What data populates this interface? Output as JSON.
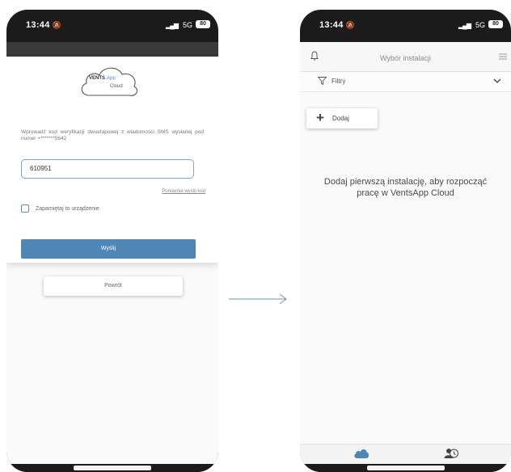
{
  "left_phone": {
    "status": {
      "time": "13:44",
      "network": "5G",
      "battery": "80"
    },
    "logo": {
      "brand": "VENTS",
      "app": "App",
      "sub": "Cloud"
    },
    "message": "Wprowadź kod weryfikacji dwuetapowej z wiadomości SMS wysłanej pod numer +*******5642",
    "code_input": {
      "value": "610951"
    },
    "resend_link": "Ponownie wyślij kod",
    "remember_label": "Zapamiętaj to urządzenie",
    "send_button": "Wyślij",
    "back_button": "Powrót"
  },
  "right_phone": {
    "status": {
      "time": "13:44",
      "network": "5G",
      "battery": "80"
    },
    "header_title": "Wybór instalacji",
    "filter_label": "Filtry",
    "add_button": "Dodaj",
    "empty_message": "Dodaj pierwszą instalację, aby rozpocząć pracę w VentsApp Cloud",
    "tabs": [
      {
        "icon": "cloud-icon",
        "active": true,
        "color": "#4f86b8"
      },
      {
        "icon": "user-icon",
        "active": false,
        "color": "#444444"
      }
    ]
  },
  "colors": {
    "accent": "#4f86b8",
    "phone_frame": "#1b1b1b",
    "arrow": "#6f93b9"
  }
}
